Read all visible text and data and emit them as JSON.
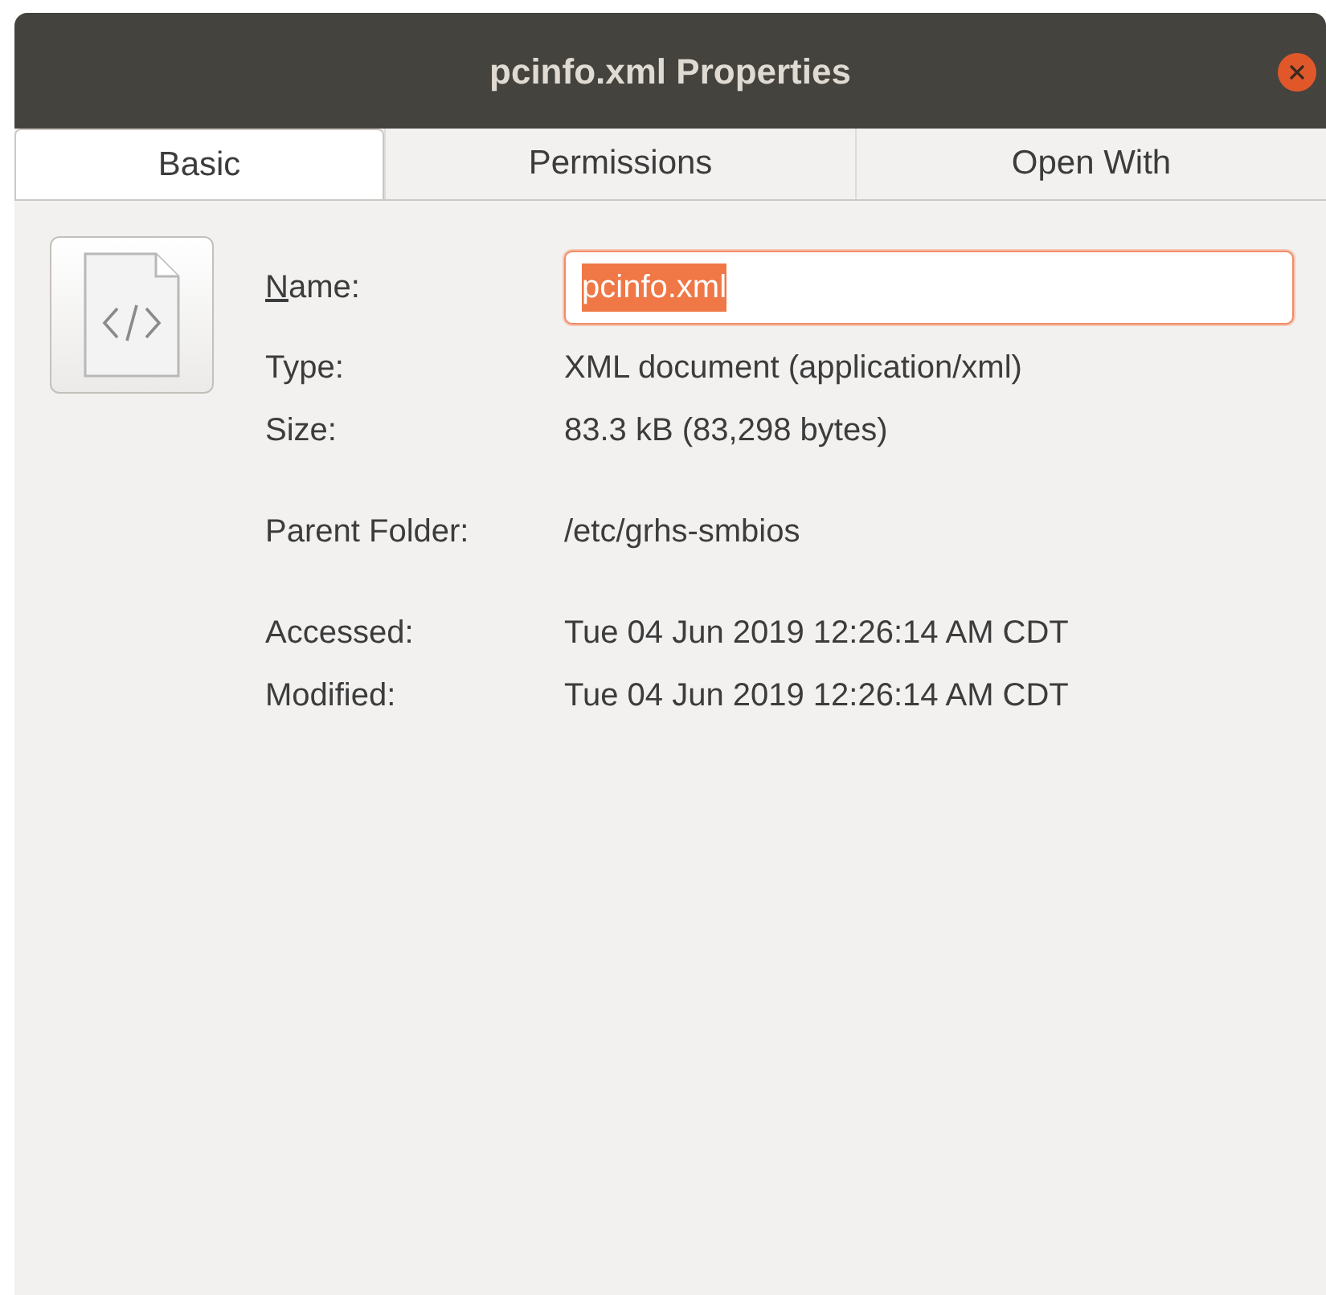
{
  "window": {
    "title": "pcinfo.xml Properties"
  },
  "tabs": [
    {
      "label": "Basic",
      "selected": true
    },
    {
      "label": "Permissions",
      "selected": false
    },
    {
      "label": "Open With",
      "selected": false
    }
  ],
  "name_field": {
    "label": "Name:",
    "mnemonic_underlined": true,
    "value": "pcinfo.xml",
    "text_selected": true
  },
  "groups": [
    [
      {
        "label": "Type:",
        "value": "XML document (application/xml)"
      },
      {
        "label": "Size:",
        "value": "83.3 kB (83,298 bytes)"
      }
    ],
    [
      {
        "label": "Parent Folder:",
        "value": "/etc/grhs-smbios"
      }
    ],
    [
      {
        "label": "Accessed:",
        "value": "Tue 04 Jun 2019 12:26:14 AM CDT"
      },
      {
        "label": "Modified:",
        "value": "Tue 04 Jun 2019 12:26:14 AM CDT"
      }
    ]
  ]
}
